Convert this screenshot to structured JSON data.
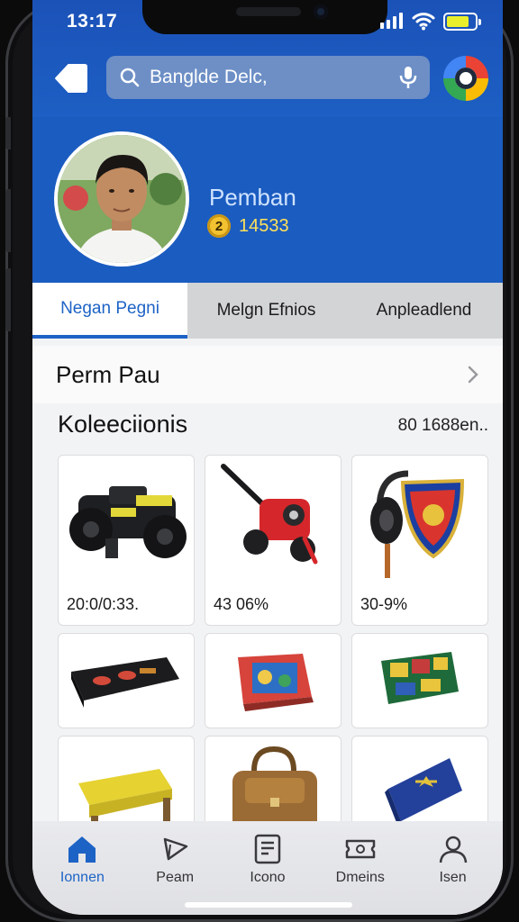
{
  "status_bar": {
    "time": "13:17"
  },
  "header": {
    "search_value": "Banglde Delc,"
  },
  "profile": {
    "name": "Pemban",
    "coin_symbol": "2",
    "points": "14533"
  },
  "tabs": [
    {
      "label": "Negan Pegni",
      "active": true
    },
    {
      "label": "Melgn Efnios",
      "active": false
    },
    {
      "label": "Anpleadlend",
      "active": false
    }
  ],
  "section": {
    "title": "Perm Pau"
  },
  "collection": {
    "title": "Koleeciionis",
    "count": "80 1688en..",
    "items": [
      {
        "name": "robot-toy",
        "price": "20:0/0:33."
      },
      {
        "name": "red-cannon-toy",
        "price": "43 06%"
      },
      {
        "name": "headphones-shield",
        "price": "30-9%"
      },
      {
        "name": "black-case",
        "price": ""
      },
      {
        "name": "board-game",
        "price": ""
      },
      {
        "name": "card-box",
        "price": ""
      },
      {
        "name": "yellow-stool",
        "price": ""
      },
      {
        "name": "leather-bag",
        "price": ""
      },
      {
        "name": "blue-folder",
        "price": ""
      }
    ]
  },
  "bottom_nav": [
    {
      "label": "Ionnen",
      "icon": "home-icon",
      "active": true
    },
    {
      "label": "Peam",
      "icon": "send-icon",
      "active": false
    },
    {
      "label": "Icono",
      "icon": "list-icon",
      "active": false
    },
    {
      "label": "Dmeins",
      "icon": "ticket-icon",
      "active": false
    },
    {
      "label": "Isen",
      "icon": "user-icon",
      "active": false
    }
  ],
  "colors": {
    "primary_blue": "#1d5fc4",
    "points_yellow": "#ffe25a"
  }
}
